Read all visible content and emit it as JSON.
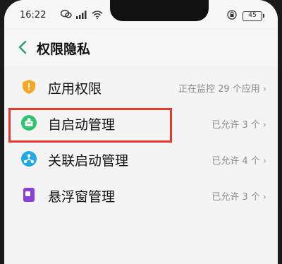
{
  "status_bar": {
    "time": "16:22",
    "battery": "45",
    "icons": [
      "wechat-icon",
      "signal-icon",
      "wifi-icon",
      "lock-rotation-icon"
    ]
  },
  "header": {
    "title": "权限隐私"
  },
  "items": [
    {
      "label": "应用权限",
      "status": "正在监控 29 个应用",
      "icon": "shield-icon",
      "icon_color": "#f5a623"
    },
    {
      "label": "自启动管理",
      "status": "已允许 3 个",
      "icon": "auto-start-icon",
      "icon_color": "#2ec46d"
    },
    {
      "label": "关联启动管理",
      "status": "已允许 4 个",
      "icon": "associated-start-icon",
      "icon_color": "#22a8e6"
    },
    {
      "label": "悬浮窗管理",
      "status": "已允许 3 个",
      "icon": "floating-window-icon",
      "icon_color": "#8b3fd9"
    }
  ],
  "colors": {
    "highlight_border": "#e23a2e",
    "status_text": "#8a8a8a"
  }
}
